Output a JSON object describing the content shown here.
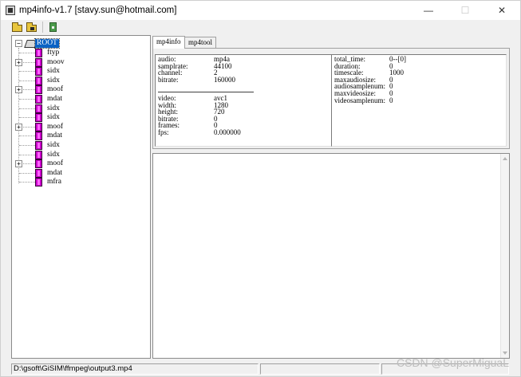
{
  "window": {
    "title": "mp4info-v1.7 [stavy.sun@hotmail.com]",
    "minimize_glyph": "—",
    "maximize_glyph": "☐",
    "close_glyph": "✕"
  },
  "toolbar": {
    "buttons": [
      {
        "icon": "open-folder-icon"
      },
      {
        "icon": "open-folder-alt-icon"
      },
      {
        "icon": "exit-icon"
      }
    ]
  },
  "tree": {
    "root_label": "ROOT",
    "items": [
      {
        "label": "ftyp",
        "expandable": false
      },
      {
        "label": "moov",
        "expandable": true
      },
      {
        "label": "sidx",
        "expandable": false
      },
      {
        "label": "sidx",
        "expandable": false
      },
      {
        "label": "moof",
        "expandable": true
      },
      {
        "label": "mdat",
        "expandable": false
      },
      {
        "label": "sidx",
        "expandable": false
      },
      {
        "label": "sidx",
        "expandable": false
      },
      {
        "label": "moof",
        "expandable": true
      },
      {
        "label": "mdat",
        "expandable": false
      },
      {
        "label": "sidx",
        "expandable": false
      },
      {
        "label": "sidx",
        "expandable": false
      },
      {
        "label": "moof",
        "expandable": true
      },
      {
        "label": "mdat",
        "expandable": false
      },
      {
        "label": "mfra",
        "expandable": false
      }
    ]
  },
  "tabs": [
    {
      "label": "mp4info",
      "active": true
    },
    {
      "label": "mp4tool",
      "active": false
    }
  ],
  "info": {
    "audio": [
      {
        "key": "audio:",
        "value": "mp4a"
      },
      {
        "key": "samplrate:",
        "value": "44100"
      },
      {
        "key": "channel:",
        "value": "2"
      },
      {
        "key": "bitrate:",
        "value": "160000"
      }
    ],
    "video": [
      {
        "key": "video:",
        "value": "avc1"
      },
      {
        "key": "width:",
        "value": "1280"
      },
      {
        "key": "height:",
        "value": "720"
      },
      {
        "key": "bitrate:",
        "value": "0"
      },
      {
        "key": "frames:",
        "value": "0"
      },
      {
        "key": "fps:",
        "value": "0.000000"
      }
    ],
    "timing": [
      {
        "key": "total_time:",
        "value": "0--[0]"
      },
      {
        "key": "duration:",
        "value": "0"
      },
      {
        "key": "timescale:",
        "value": "1000"
      },
      {
        "key": "maxaudiosize:",
        "value": "0"
      },
      {
        "key": "audiosamplenum:",
        "value": "0"
      },
      {
        "key": "maxvideosize:",
        "value": "0"
      },
      {
        "key": "videosamplenum:",
        "value": "0"
      }
    ]
  },
  "status": {
    "path": "D:\\gsoft\\GiSIM\\ffmpeg\\output3.mp4",
    "field2": "",
    "field3": ""
  },
  "watermark": "CSDN @SuperMiguaL"
}
